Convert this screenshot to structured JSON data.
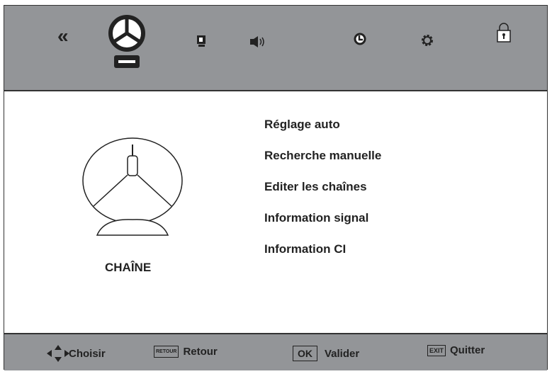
{
  "header": {
    "icons": [
      "back-icon",
      "channel-icon",
      "picture-icon",
      "sound-icon",
      "time-icon",
      "settings-icon",
      "lock-icon"
    ],
    "active": "channel-icon"
  },
  "main": {
    "title": "CHAÎNE",
    "menu": [
      "Réglage auto",
      "Recherche manuelle",
      "Editer les chaînes",
      "Information signal",
      "Information CI"
    ]
  },
  "footer": {
    "choose": "Choisir",
    "back_key": "RETOUR",
    "back": "Retour",
    "ok_key": "OK",
    "ok": "Valider",
    "exit_key": "EXIT",
    "exit": "Quitter"
  },
  "colors": {
    "bar": "#939598",
    "text": "#222222"
  }
}
